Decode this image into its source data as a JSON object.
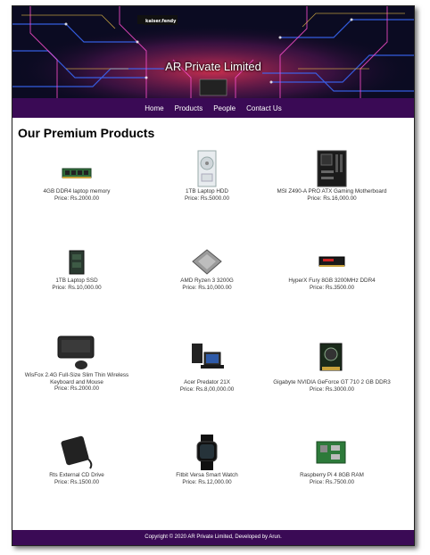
{
  "site": {
    "title": "AR Private Limited",
    "banner_chip_label": "kaiser.fendy"
  },
  "nav": {
    "items": [
      {
        "label": "Home"
      },
      {
        "label": "Products"
      },
      {
        "label": "People"
      },
      {
        "label": "Contact Us"
      }
    ]
  },
  "main": {
    "heading": "Our Premium Products",
    "products": [
      {
        "name": "4GB DDR4 laptop memory",
        "price": "Price: Rs.2000.00",
        "icon": "ram-stick-icon"
      },
      {
        "name": "1TB Laptop HDD",
        "price": "Price: Rs.5000.00",
        "icon": "hdd-icon"
      },
      {
        "name": "MSI Z490-A PRO ATX Gaming Motherboard",
        "price": "Price: Rs.16,000.00",
        "icon": "motherboard-icon"
      },
      {
        "name": "1TB Laptop SSD",
        "price": "Price: Rs.10,000.00",
        "icon": "ssd-icon"
      },
      {
        "name": "AMD Ryzen 3 3200G",
        "price": "Price: Rs.10,000.00",
        "icon": "cpu-icon"
      },
      {
        "name": "HyperX Fury 8GB 3200MHz DDR4",
        "price": "Price: Rs.3500.00",
        "icon": "ram-module-icon"
      },
      {
        "name": "WisFox 2.4G Full-Size Slim Thin Wireless Keyboard and Mouse",
        "price": "Price: Rs.2000.00",
        "icon": "keyboard-icon"
      },
      {
        "name": "Acer Predator 21X",
        "price": "Price: Rs.8,00,000.00",
        "icon": "laptop-icon"
      },
      {
        "name": "Gigabyte NVIDIA GeForce GT 710 2 GB DDR3",
        "price": "Price: Rs.3000.00",
        "icon": "graphics-card-icon"
      },
      {
        "name": "Rts External CD Drive",
        "price": "Price: Rs.1500.00",
        "icon": "cd-drive-icon"
      },
      {
        "name": "Fitbit Versa Smart Watch",
        "price": "Price: Rs.12,000.00",
        "icon": "smartwatch-icon"
      },
      {
        "name": "Raspberry Pi 4 8GB RAM",
        "price": "Price: Rs.7500.00",
        "icon": "raspberry-pi-icon"
      }
    ]
  },
  "footer": {
    "text": "Copyright © 2020 AR Private Limited, Developed by Arun."
  },
  "colors": {
    "nav_bg": "#3a0a55",
    "footer_bg": "#3a0a55",
    "page_bg": "#ffffff"
  }
}
